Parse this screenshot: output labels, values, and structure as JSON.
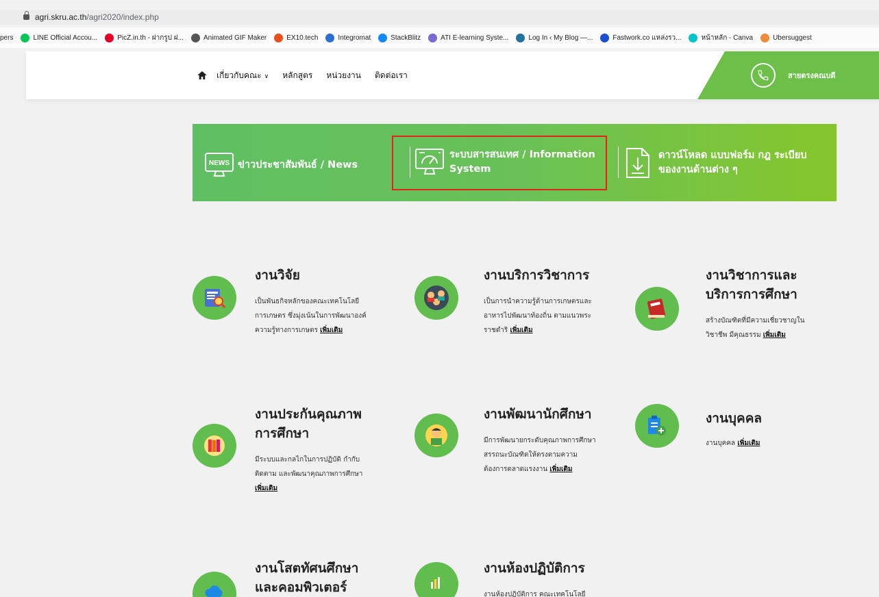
{
  "browser": {
    "url_host": "agri.skru.ac.th",
    "url_path": "/agri2020/index.php",
    "bookmarks": [
      {
        "label": "pers",
        "icon": "none",
        "color": ""
      },
      {
        "label": "LINE Official Accou...",
        "icon": "line-icon",
        "color": "#06c755"
      },
      {
        "label": "PicZ.in.th - ฝากรูป ฝ...",
        "icon": "pinterest-icon",
        "color": "#e60023"
      },
      {
        "label": "Animated GIF Maker",
        "icon": "gif-maker-icon",
        "color": "#555555"
      },
      {
        "label": "EX10.tech",
        "icon": "ex10-icon",
        "color": "#e8501e"
      },
      {
        "label": "Integromat",
        "icon": "integromat-icon",
        "color": "#2d6fd1"
      },
      {
        "label": "StackBlitz",
        "icon": "stackblitz-icon",
        "color": "#1389fd"
      },
      {
        "label": "ATI E-learning Syste...",
        "icon": "ati-icon",
        "color": "#7a6bd0"
      },
      {
        "label": "Log In ‹ My Blog —...",
        "icon": "wordpress-icon",
        "color": "#21759b"
      },
      {
        "label": "Fastwork.co แหล่งรว...",
        "icon": "fastwork-icon",
        "color": "#1f4fd1"
      },
      {
        "label": "หน้าหลัก - Canva",
        "icon": "canva-icon",
        "color": "#00c4cc"
      },
      {
        "label": "Ubersuggest",
        "icon": "ubersuggest-icon",
        "color": "#f08a3c"
      }
    ]
  },
  "header": {
    "nav": [
      {
        "label": "เกี่ยวกับคณะ",
        "has_dropdown": true
      },
      {
        "label": "หลักสูตร",
        "has_dropdown": false
      },
      {
        "label": "หน่วยงาน",
        "has_dropdown": false
      },
      {
        "label": "ติดต่อเรา",
        "has_dropdown": false
      }
    ],
    "hotline": "สายตรงคณบดี"
  },
  "banner": {
    "news": "ข่าวประชาสัมพันธ์ / News",
    "news_icon_text": "NEWS",
    "info_line1": "ระบบสารสนเทศ / Information",
    "info_line2": "System",
    "download_line1": "ดาวน์โหลด แบบฟอร์ม กฎ ระเบียบ",
    "download_line2": "ของงานด้านต่าง ๆ"
  },
  "cards": [
    {
      "title1": "งานวิจัย",
      "title2": "",
      "desc": [
        "เป็นพันธกิจหลักของคณะเทคโนโลยี",
        "การเกษตร ซึ่งมุ่งเน้นในการพัฒนาองค์",
        "ความรู้ทางการเกษตร"
      ],
      "more": "เพิ่มเติม",
      "icon": "research-icon"
    },
    {
      "title1": "งานบริการวิชาการ",
      "title2": "",
      "desc": [
        "เป็นการนำความรู้ด้านการเกษตรและ",
        "อาหารไปพัฒนาท้องถิ่น ตามแนวพระ",
        "ราชดำริ"
      ],
      "more": "เพิ่มเติม",
      "icon": "people-icon"
    },
    {
      "title1": "งานวิชาการและ",
      "title2": "บริการการศึกษา",
      "desc": [
        "สร้างบัณฑิตที่มีความเชี่ยวชาญใน",
        "วิชาชีพ มีคุณธรรม"
      ],
      "more": "เพิ่มเติม",
      "icon": "book-icon"
    },
    {
      "title1": "งานประกันคุณภาพ",
      "title2": "การศึกษา",
      "desc": [
        "มีระบบและกลไกในการปฏิบัติ กำกับ",
        "ติดตาม และพัฒนาคุณภาพการศึกษา",
        ""
      ],
      "more": "เพิ่มเติม",
      "icon": "books-icon"
    },
    {
      "title1": "งานพัฒนานักศึกษา",
      "title2": "",
      "desc": [
        "มีการพัฒนายกระดับคุณภาพการศึกษา",
        "สรรถนะบัณฑิตให้ตรงตามความ",
        "ต้องการตลาดแรงงาน"
      ],
      "more": "เพิ่มเติม",
      "icon": "student-icon"
    },
    {
      "title1": "งานบุคคล",
      "title2": "",
      "desc": [
        "งานบุคคล"
      ],
      "more": "เพิ่มเติม",
      "icon": "clipboard-add-icon"
    },
    {
      "title1": "งานโสตทัศนศึกษา",
      "title2": "และคอมพิวเตอร์",
      "desc": [],
      "more": "",
      "icon": "cloud-icon"
    },
    {
      "title1": "งานห้องปฏิบัติการ",
      "title2": "",
      "desc": [
        "งานห้องปฏิบัติการ คณะเทคโนโลยี"
      ],
      "more": "",
      "icon": "lab-chart-icon"
    }
  ],
  "colors": {
    "brand_green": "#6cc04a",
    "highlight_red": "#e2231a"
  }
}
